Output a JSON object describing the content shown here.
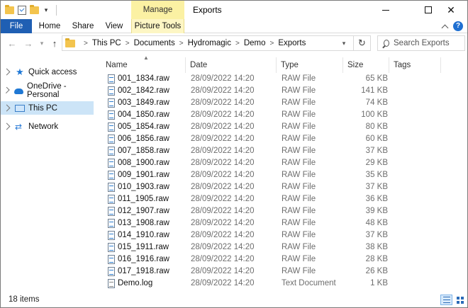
{
  "window": {
    "title": "Exports",
    "contextual_group": "Manage"
  },
  "ribbon": {
    "tabs": [
      {
        "label": "File"
      },
      {
        "label": "Home"
      },
      {
        "label": "Share"
      },
      {
        "label": "View"
      },
      {
        "label": "Picture Tools"
      }
    ]
  },
  "address": {
    "crumbs": [
      "This PC",
      "Documents",
      "Hydromagic",
      "Demo",
      "Exports"
    ],
    "search_placeholder": "Search Exports"
  },
  "sidebar": {
    "items": [
      {
        "label": "Quick access",
        "icon": "star-icon",
        "selected": false
      },
      {
        "label": "OneDrive - Personal",
        "icon": "cloud-icon",
        "selected": false
      },
      {
        "label": "This PC",
        "icon": "pc-icon",
        "selected": true
      },
      {
        "label": "Network",
        "icon": "network-icon",
        "selected": false
      }
    ]
  },
  "columns": [
    {
      "label": "Name"
    },
    {
      "label": "Date"
    },
    {
      "label": "Type"
    },
    {
      "label": "Size"
    },
    {
      "label": "Tags"
    }
  ],
  "files": [
    {
      "name": "001_1834.raw",
      "date": "28/09/2022 14:20",
      "type": "RAW File",
      "size": "65 KB"
    },
    {
      "name": "002_1842.raw",
      "date": "28/09/2022 14:20",
      "type": "RAW File",
      "size": "141 KB"
    },
    {
      "name": "003_1849.raw",
      "date": "28/09/2022 14:20",
      "type": "RAW File",
      "size": "74 KB"
    },
    {
      "name": "004_1850.raw",
      "date": "28/09/2022 14:20",
      "type": "RAW File",
      "size": "100 KB"
    },
    {
      "name": "005_1854.raw",
      "date": "28/09/2022 14:20",
      "type": "RAW File",
      "size": "80 KB"
    },
    {
      "name": "006_1856.raw",
      "date": "28/09/2022 14:20",
      "type": "RAW File",
      "size": "60 KB"
    },
    {
      "name": "007_1858.raw",
      "date": "28/09/2022 14:20",
      "type": "RAW File",
      "size": "37 KB"
    },
    {
      "name": "008_1900.raw",
      "date": "28/09/2022 14:20",
      "type": "RAW File",
      "size": "29 KB"
    },
    {
      "name": "009_1901.raw",
      "date": "28/09/2022 14:20",
      "type": "RAW File",
      "size": "35 KB"
    },
    {
      "name": "010_1903.raw",
      "date": "28/09/2022 14:20",
      "type": "RAW File",
      "size": "37 KB"
    },
    {
      "name": "011_1905.raw",
      "date": "28/09/2022 14:20",
      "type": "RAW File",
      "size": "36 KB"
    },
    {
      "name": "012_1907.raw",
      "date": "28/09/2022 14:20",
      "type": "RAW File",
      "size": "39 KB"
    },
    {
      "name": "013_1908.raw",
      "date": "28/09/2022 14:20",
      "type": "RAW File",
      "size": "48 KB"
    },
    {
      "name": "014_1910.raw",
      "date": "28/09/2022 14:20",
      "type": "RAW File",
      "size": "37 KB"
    },
    {
      "name": "015_1911.raw",
      "date": "28/09/2022 14:20",
      "type": "RAW File",
      "size": "38 KB"
    },
    {
      "name": "016_1916.raw",
      "date": "28/09/2022 14:20",
      "type": "RAW File",
      "size": "28 KB"
    },
    {
      "name": "017_1918.raw",
      "date": "28/09/2022 14:20",
      "type": "RAW File",
      "size": "26 KB"
    },
    {
      "name": "Demo.log",
      "date": "28/09/2022 14:20",
      "type": "Text Document",
      "size": "1 KB"
    }
  ],
  "status": {
    "count_text": "18 items"
  },
  "colors": {
    "file_tab": "#1f5fb3",
    "manage_tab": "#fbf1a3",
    "selected_nav": "#cce4f7",
    "accent": "#1e78d6"
  }
}
